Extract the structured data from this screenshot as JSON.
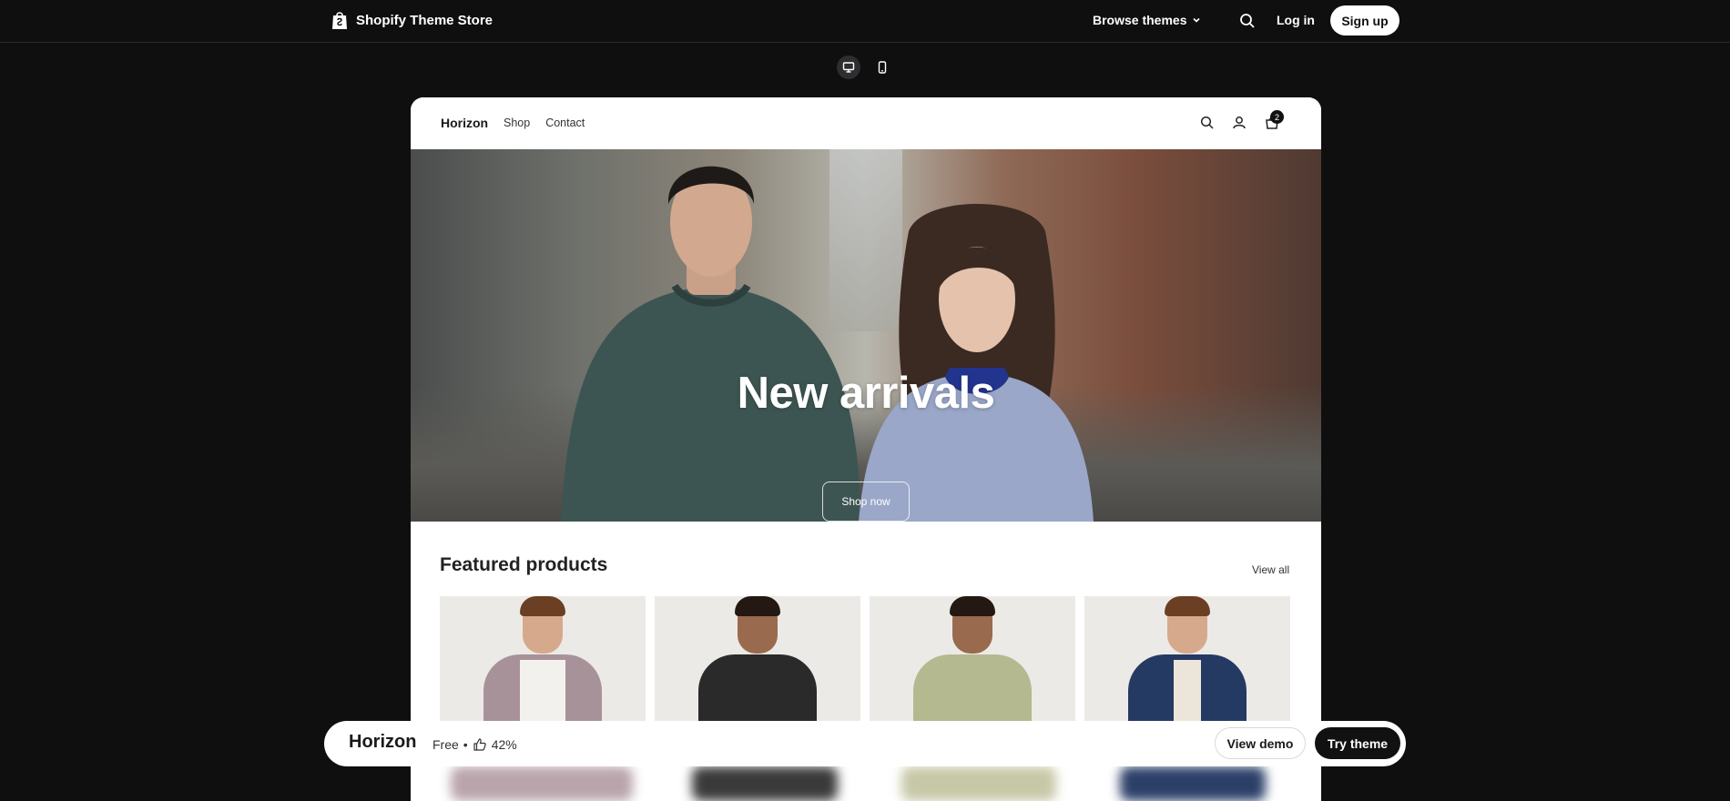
{
  "topnav": {
    "brand": "Shopify Theme Store",
    "browse_label": "Browse themes",
    "login_label": "Log in",
    "signup_label": "Sign up"
  },
  "device_toggle": {
    "options": [
      "desktop",
      "mobile"
    ],
    "selected": "desktop"
  },
  "store": {
    "logo": "Horizon",
    "nav": [
      "Shop",
      "Contact"
    ],
    "cart_count": "2",
    "hero": {
      "title": "New arrivals",
      "button": "Shop now"
    },
    "featured": {
      "title": "Featured products",
      "view_all": "View all"
    }
  },
  "bottombar": {
    "theme_name": "Horizon",
    "price": "Free",
    "separator": "•",
    "rating": "42%",
    "view_demo": "View demo",
    "try_theme": "Try theme"
  },
  "colors": {
    "background": "#0f0f10",
    "accent_dark": "#111111",
    "white": "#ffffff"
  }
}
